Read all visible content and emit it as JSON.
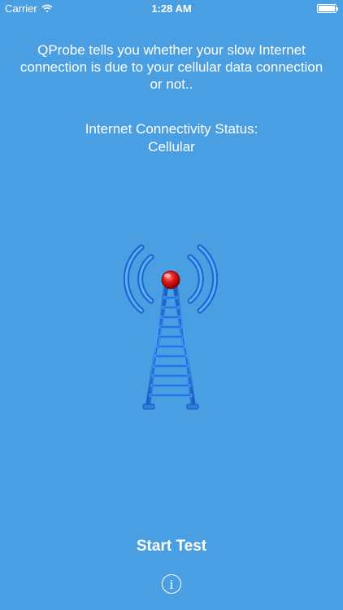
{
  "status_bar": {
    "carrier": "Carrier",
    "wifi_icon": "wifi-icon",
    "time": "1:28 AM",
    "battery_icon": "battery-icon",
    "battery_level": 1.0
  },
  "main": {
    "description": "QProbe tells you whether your slow Internet connection is due to your cellular data connection or not..",
    "status_label": "Internet Connectivity Status:",
    "status_value": "Cellular",
    "tower_icon": "cell-tower-icon"
  },
  "footer": {
    "start_test_label": "Start Test",
    "info_icon": "info-icon",
    "info_glyph": "i"
  },
  "colors": {
    "background": "#4a9fe3",
    "tower_blue": "#2f7fe0",
    "beacon_red": "#e01b1b",
    "text": "#ffffff"
  }
}
